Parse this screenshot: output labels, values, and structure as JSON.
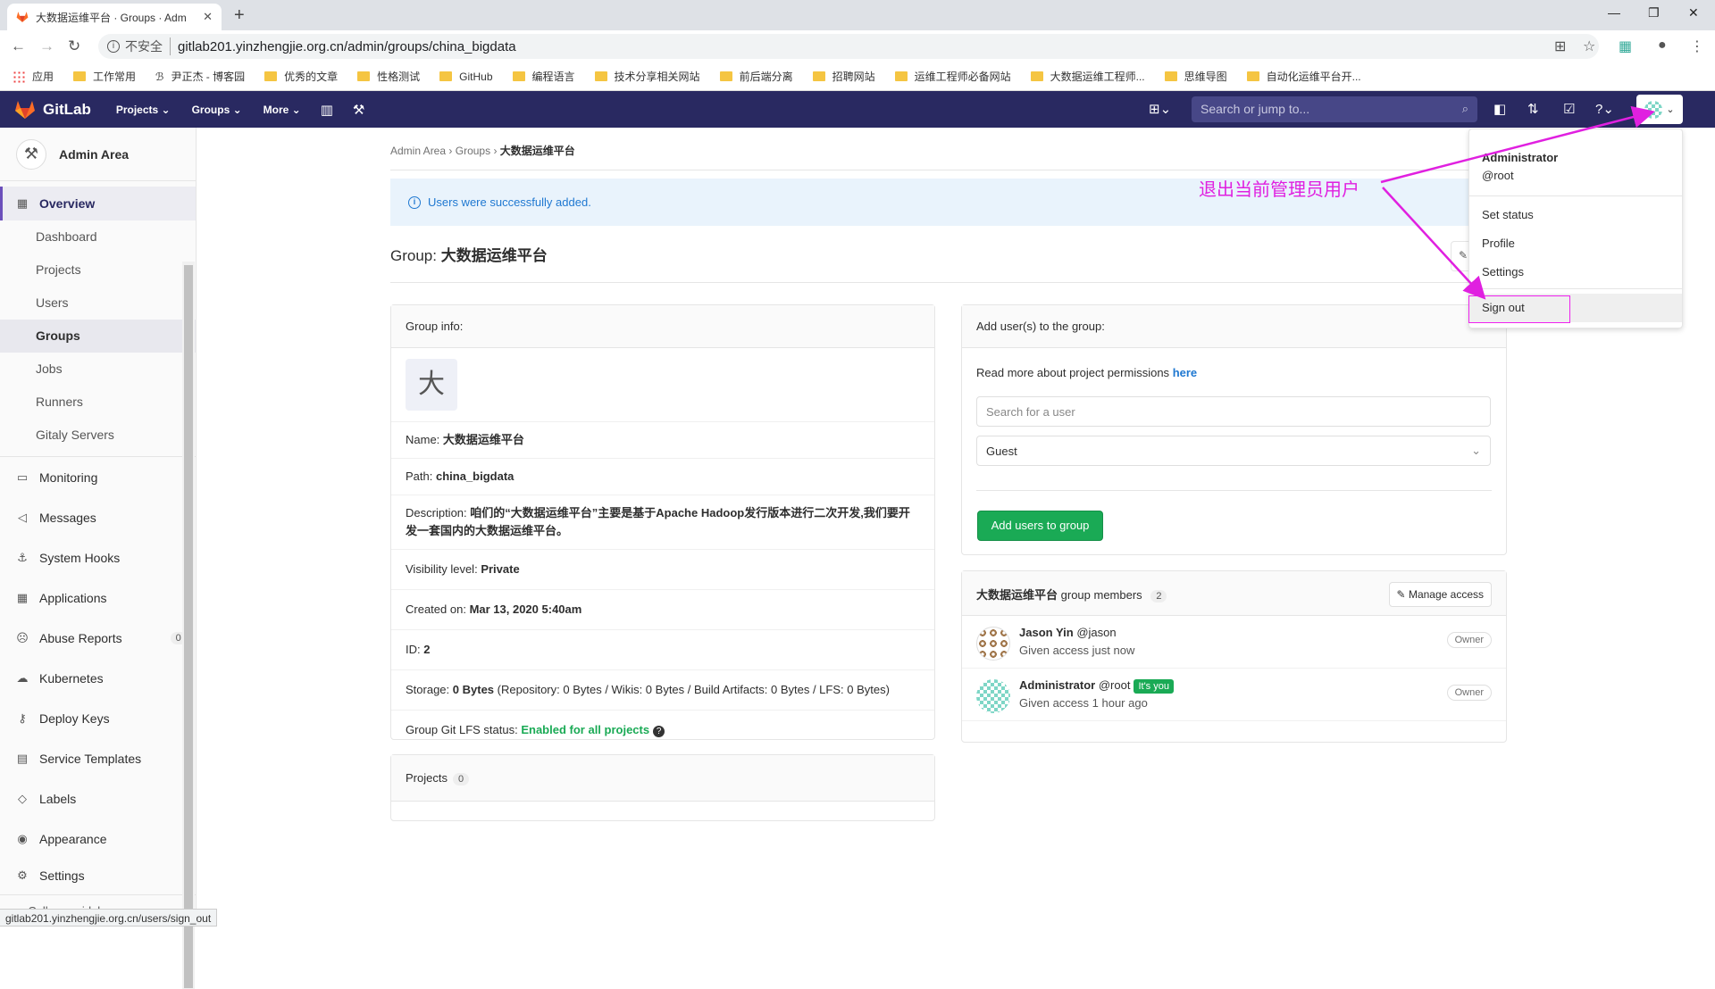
{
  "browser": {
    "tab_title": "大数据运维平台 · Groups · Adm",
    "url_insecure": "不安全",
    "url": "gitlab201.yinzhengjie.org.cn/admin/groups/china_bigdata",
    "status_url": "gitlab201.yinzhengjie.org.cn/users/sign_out"
  },
  "bookmarks": [
    "应用",
    "工作常用",
    "尹正杰 - 博客园",
    "优秀的文章",
    "性格测试",
    "GitHub",
    "编程语言",
    "技术分享相关网站",
    "前后端分离",
    "招聘网站",
    "运维工程师必备网站",
    "大数据运维工程师...",
    "思维导图",
    "自动化运维平台开..."
  ],
  "header": {
    "brand": "GitLab",
    "nav": [
      "Projects ⌄",
      "Groups ⌄",
      "More ⌄"
    ],
    "search_placeholder": "Search or jump to..."
  },
  "sidebar": {
    "title": "Admin Area",
    "overview": "Overview",
    "overview_items": [
      "Dashboard",
      "Projects",
      "Users",
      "Groups",
      "Jobs",
      "Runners",
      "Gitaly Servers"
    ],
    "items": [
      "Monitoring",
      "Messages",
      "System Hooks",
      "Applications",
      "Abuse Reports",
      "Kubernetes",
      "Deploy Keys",
      "Service Templates",
      "Labels",
      "Appearance",
      "Settings"
    ],
    "abuse_count": "0",
    "collapse": "Collapse sidebar"
  },
  "breadcrumb": [
    "Admin Area",
    "Groups",
    "大数据运维平台"
  ],
  "flash": "Users were successfully added.",
  "group": {
    "title_prefix": "Group:",
    "title_name": "大数据运维平台",
    "info_header": "Group info:",
    "avatar_letter": "大",
    "name_label": "Name:",
    "name": "大数据运维平台",
    "path_label": "Path:",
    "path": "china_bigdata",
    "desc_label": "Description:",
    "description": "咱们的“大数据运维平台”主要是基于Apache Hadoop发行版本进行二次开发,我们要开发一套国内的大数据运维平台。",
    "visibility_label": "Visibility level:",
    "visibility": "Private",
    "created_label": "Created on:",
    "created": "Mar 13, 2020 5:40am",
    "id_label": "ID:",
    "id": "2",
    "storage_label": "Storage:",
    "storage": "0 Bytes",
    "storage_detail": "(Repository: 0 Bytes / Wikis: 0 Bytes / Build Artifacts: 0 Bytes / LFS: 0 Bytes)",
    "lfs_label": "Group Git LFS status:",
    "lfs": "Enabled for all projects",
    "projects_label": "Projects",
    "projects_count": "0"
  },
  "add_users": {
    "header": "Add user(s) to the group:",
    "permissions_text": "Read more about project permissions",
    "permissions_link": "here",
    "search_placeholder": "Search for a user",
    "role": "Guest",
    "button": "Add users to group"
  },
  "members": {
    "group_name": "大数据运维平台",
    "header_suffix": "group members",
    "count": "2",
    "manage": "Manage access",
    "list": [
      {
        "name": "Jason Yin",
        "handle": "@jason",
        "access": "Given access just now",
        "role": "Owner",
        "you": ""
      },
      {
        "name": "Administrator",
        "handle": "@root",
        "access": "Given access 1 hour ago",
        "role": "Owner",
        "you": "It's you"
      }
    ]
  },
  "dropdown": {
    "name": "Administrator",
    "handle": "@root",
    "items": [
      "Set status",
      "Profile",
      "Settings"
    ],
    "signout": "Sign out"
  },
  "annotation": "退出当前管理员用户",
  "annotation_color": "#e020e0"
}
